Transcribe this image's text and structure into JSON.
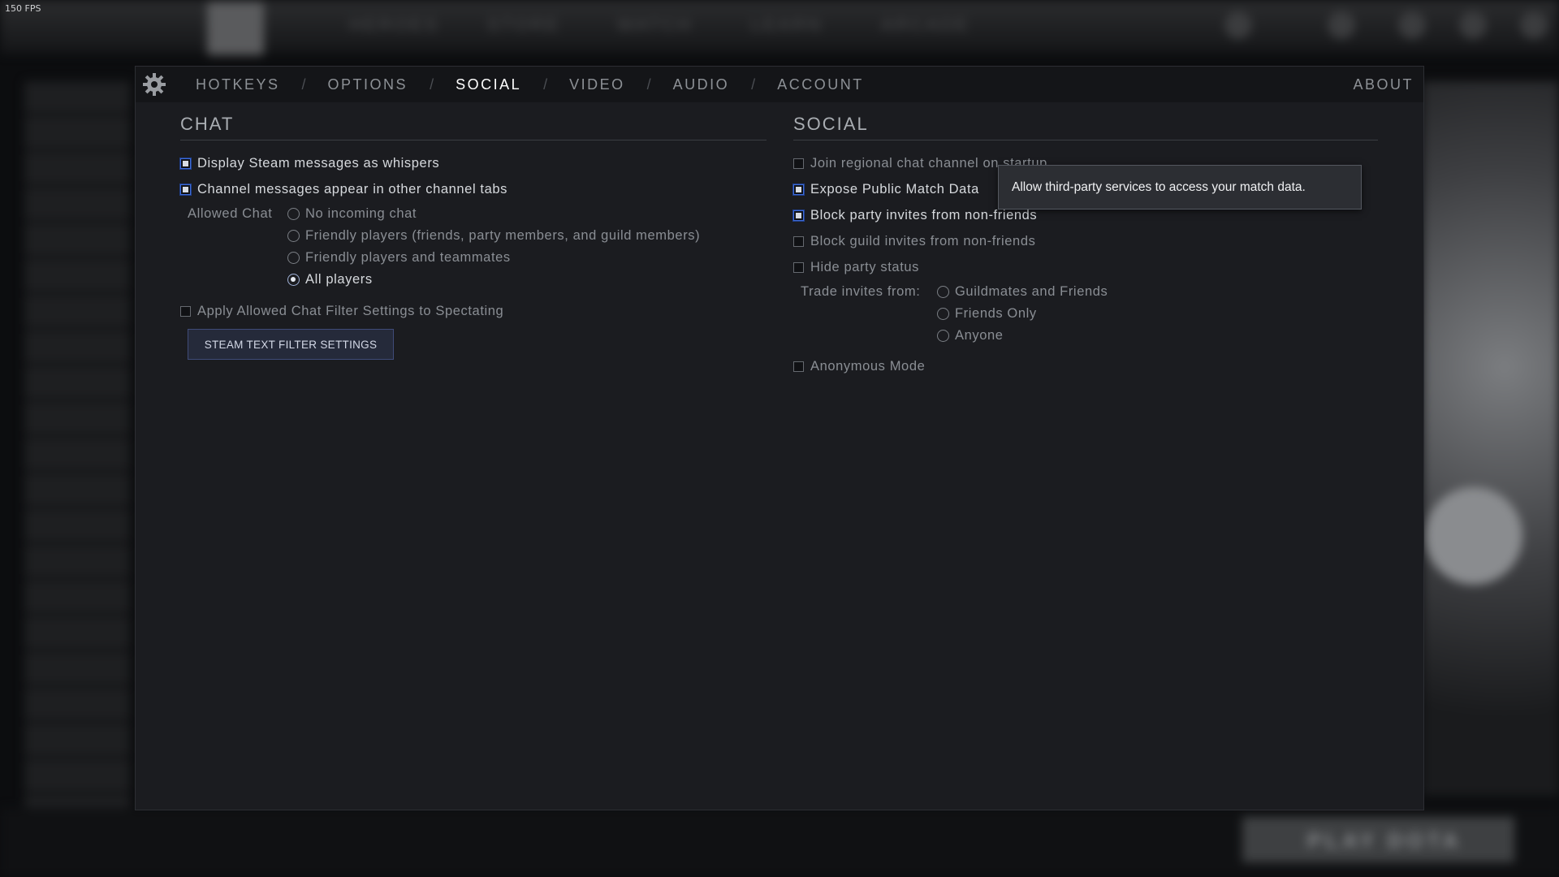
{
  "fps": "150 FPS",
  "background": {
    "nav_items": [
      "HEROES",
      "STORE",
      "WATCH",
      "LEARN",
      "ARCADE"
    ],
    "play_button": "PLAY DOTA"
  },
  "tabs": [
    "HOTKEYS",
    "OPTIONS",
    "SOCIAL",
    "VIDEO",
    "AUDIO",
    "ACCOUNT"
  ],
  "active_tab": "SOCIAL",
  "tab_separator": "/",
  "about": "ABOUT",
  "chat": {
    "title": "CHAT",
    "display_steam_whispers": {
      "label": "Display Steam messages as whispers",
      "checked": true
    },
    "channel_tabs": {
      "label": "Channel messages appear in other channel tabs",
      "checked": true
    },
    "allowed_chat": {
      "label": "Allowed Chat",
      "options": [
        {
          "label": "No incoming chat",
          "selected": false
        },
        {
          "label": "Friendly players (friends, party members, and guild members)",
          "selected": false
        },
        {
          "label": "Friendly players and teammates",
          "selected": false
        },
        {
          "label": "All players",
          "selected": true
        }
      ]
    },
    "spectating_filter": {
      "label": "Apply Allowed Chat Filter Settings to Spectating",
      "checked": false
    },
    "filter_button": "STEAM TEXT FILTER SETTINGS"
  },
  "social": {
    "title": "SOCIAL",
    "join_regional": {
      "label": "Join regional chat channel on startup",
      "checked": false
    },
    "expose_match_data": {
      "label": "Expose Public Match Data",
      "checked": true
    },
    "block_party_invites": {
      "label": "Block party invites from non-friends",
      "checked": true
    },
    "block_guild_invites": {
      "label": "Block guild invites from non-friends",
      "checked": false
    },
    "hide_party_status": {
      "label": "Hide party status",
      "checked": false
    },
    "trade_invites": {
      "label": "Trade invites from:",
      "options": [
        {
          "label": "Guildmates and Friends",
          "selected": false
        },
        {
          "label": "Friends Only",
          "selected": false
        },
        {
          "label": "Anyone",
          "selected": false
        }
      ]
    },
    "anonymous_mode": {
      "label": "Anonymous Mode",
      "checked": false
    }
  },
  "tooltip": "Allow third-party services to access your match data."
}
